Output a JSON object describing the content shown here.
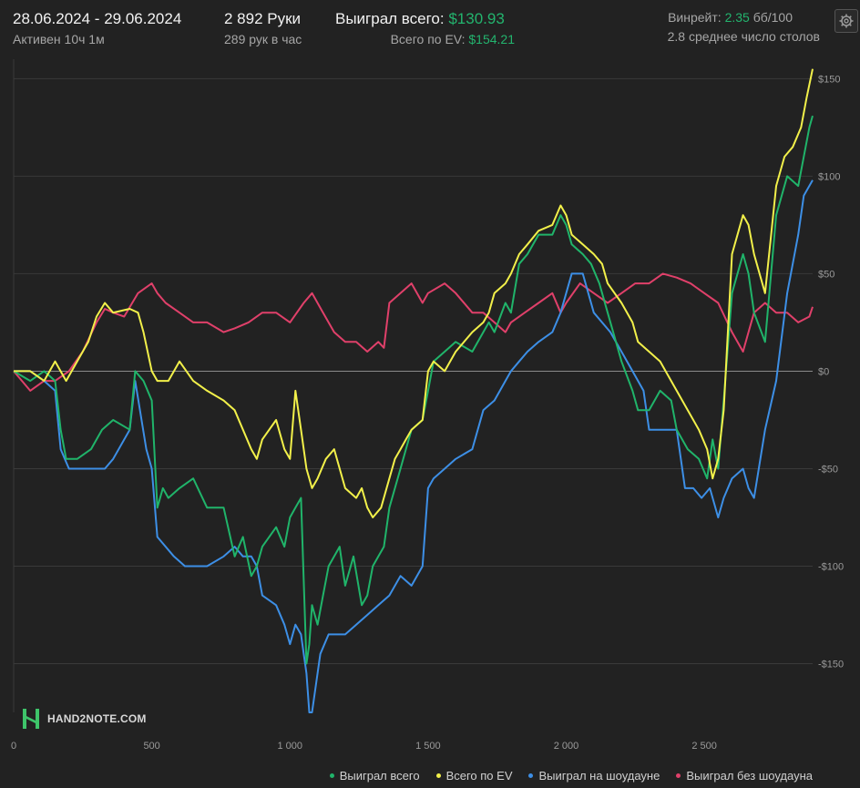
{
  "header": {
    "date_range": "28.06.2024 - 29.06.2024",
    "active_time": "Активен 10ч 1м",
    "hands_count": "2 892 Руки",
    "hands_per_hour": "289 рук в час",
    "won_total_label": "Выиграл всего:",
    "won_total_value": "$130.93",
    "ev_total_label": "Всего по EV:",
    "ev_total_value": "$154.21",
    "winrate_label": "Винрейт:",
    "winrate_value": "2.35",
    "winrate_unit": "бб/100",
    "avg_tables": "2.8 среднее число столов"
  },
  "settings_icon": "gear-icon",
  "logo": {
    "icon": "hand2note-logo-icon",
    "text": "HAND2NOTE.COM"
  },
  "colors": {
    "background": "#222222",
    "grid": "#3a3a3a",
    "zero_line": "#8a8a8a",
    "won_total": "#20b46a",
    "ev_total": "#f2f04a",
    "showdown": "#3d8fe6",
    "non_showdown": "#e0406a",
    "accent_green": "#23b46e"
  },
  "legend": [
    {
      "label": "Выиграл всего",
      "color": "#20b46a"
    },
    {
      "label": "Всего по EV",
      "color": "#f2f04a"
    },
    {
      "label": "Выиграл на шоудауне",
      "color": "#3d8fe6"
    },
    {
      "label": "Выиграл без шоудауна",
      "color": "#e0406a"
    }
  ],
  "chart_data": {
    "type": "line",
    "xlabel": "",
    "ylabel": "",
    "xlim": [
      0,
      2892
    ],
    "ylim": [
      -175,
      160
    ],
    "x_ticks": [
      0,
      500,
      1000,
      1500,
      2000,
      2500
    ],
    "x_tick_labels": [
      "0",
      "500",
      "1 000",
      "1 500",
      "2 000",
      "2 500"
    ],
    "y_ticks": [
      150,
      100,
      50,
      0,
      -50,
      -100,
      -150
    ],
    "y_tick_labels": [
      "$150",
      "$100",
      "$50",
      "$0",
      "-$50",
      "-$100",
      "-$150"
    ],
    "grid": true,
    "legend_position": "bottom-right",
    "series": [
      {
        "name": "Выиграл всего",
        "color": "#20b46a",
        "x": [
          0,
          60,
          110,
          150,
          170,
          190,
          230,
          280,
          320,
          360,
          420,
          440,
          470,
          500,
          520,
          540,
          560,
          600,
          650,
          700,
          760,
          800,
          830,
          860,
          880,
          900,
          950,
          980,
          1000,
          1020,
          1040,
          1060,
          1070,
          1080,
          1100,
          1120,
          1140,
          1180,
          1200,
          1230,
          1260,
          1280,
          1300,
          1320,
          1340,
          1360,
          1380,
          1400,
          1420,
          1440,
          1480,
          1500,
          1520,
          1560,
          1600,
          1660,
          1700,
          1720,
          1740,
          1780,
          1800,
          1830,
          1860,
          1900,
          1950,
          1980,
          2000,
          2020,
          2060,
          2090,
          2120,
          2150,
          2200,
          2240,
          2260,
          2300,
          2340,
          2380,
          2400,
          2440,
          2480,
          2510,
          2530,
          2550,
          2570,
          2600,
          2640,
          2660,
          2680,
          2720,
          2760,
          2800,
          2840,
          2860,
          2880,
          2892
        ],
        "y": [
          0,
          -5,
          0,
          -5,
          -30,
          -45,
          -45,
          -40,
          -30,
          -25,
          -30,
          0,
          -5,
          -15,
          -70,
          -60,
          -65,
          -60,
          -55,
          -70,
          -70,
          -95,
          -85,
          -105,
          -100,
          -90,
          -80,
          -90,
          -75,
          -70,
          -65,
          -150,
          -140,
          -120,
          -130,
          -115,
          -100,
          -90,
          -110,
          -95,
          -120,
          -115,
          -100,
          -95,
          -90,
          -70,
          -60,
          -50,
          -40,
          -30,
          -25,
          -10,
          5,
          10,
          15,
          10,
          20,
          25,
          20,
          35,
          30,
          55,
          60,
          70,
          70,
          80,
          75,
          65,
          60,
          55,
          45,
          30,
          5,
          -10,
          -20,
          -20,
          -10,
          -15,
          -30,
          -40,
          -45,
          -55,
          -35,
          -50,
          -15,
          40,
          60,
          50,
          30,
          15,
          80,
          100,
          95,
          110,
          125,
          131
        ]
      },
      {
        "name": "Всего по EV",
        "color": "#f2f04a",
        "x": [
          0,
          60,
          110,
          150,
          190,
          230,
          270,
          300,
          330,
          360,
          420,
          450,
          470,
          500,
          520,
          560,
          600,
          650,
          700,
          760,
          800,
          830,
          860,
          880,
          900,
          950,
          980,
          1000,
          1020,
          1040,
          1060,
          1080,
          1100,
          1130,
          1160,
          1200,
          1240,
          1260,
          1280,
          1300,
          1330,
          1360,
          1380,
          1400,
          1420,
          1440,
          1480,
          1500,
          1520,
          1560,
          1600,
          1660,
          1700,
          1720,
          1740,
          1780,
          1800,
          1830,
          1860,
          1900,
          1950,
          1980,
          2000,
          2020,
          2060,
          2100,
          2130,
          2150,
          2200,
          2240,
          2260,
          2300,
          2340,
          2380,
          2400,
          2440,
          2480,
          2510,
          2530,
          2550,
          2570,
          2600,
          2640,
          2660,
          2680,
          2720,
          2760,
          2790,
          2820,
          2850,
          2870,
          2892
        ],
        "y": [
          0,
          0,
          -5,
          5,
          -5,
          5,
          15,
          28,
          35,
          30,
          32,
          30,
          20,
          0,
          -5,
          -5,
          5,
          -5,
          -10,
          -15,
          -20,
          -30,
          -40,
          -45,
          -35,
          -25,
          -40,
          -45,
          -10,
          -30,
          -50,
          -60,
          -55,
          -45,
          -40,
          -60,
          -65,
          -60,
          -70,
          -75,
          -70,
          -55,
          -45,
          -40,
          -35,
          -30,
          -25,
          0,
          5,
          0,
          10,
          20,
          25,
          30,
          40,
          45,
          50,
          60,
          65,
          72,
          75,
          85,
          80,
          70,
          65,
          60,
          55,
          45,
          35,
          25,
          15,
          10,
          5,
          -5,
          -10,
          -20,
          -30,
          -40,
          -55,
          -45,
          -20,
          60,
          80,
          75,
          60,
          40,
          95,
          110,
          115,
          125,
          140,
          155
        ]
      },
      {
        "name": "Выиграл на шоудауне",
        "color": "#3d8fe6",
        "x": [
          0,
          60,
          110,
          150,
          170,
          200,
          250,
          300,
          330,
          360,
          420,
          440,
          480,
          500,
          520,
          580,
          620,
          700,
          760,
          800,
          830,
          860,
          880,
          900,
          950,
          980,
          1000,
          1020,
          1040,
          1060,
          1070,
          1080,
          1110,
          1140,
          1200,
          1240,
          1280,
          1320,
          1360,
          1400,
          1440,
          1480,
          1500,
          1520,
          1560,
          1600,
          1660,
          1700,
          1740,
          1780,
          1800,
          1830,
          1860,
          1900,
          1950,
          1980,
          2000,
          2020,
          2060,
          2100,
          2160,
          2200,
          2240,
          2280,
          2300,
          2400,
          2430,
          2460,
          2490,
          2520,
          2550,
          2570,
          2600,
          2640,
          2660,
          2680,
          2720,
          2760,
          2800,
          2840,
          2860,
          2892
        ],
        "y": [
          0,
          0,
          -5,
          -10,
          -40,
          -50,
          -50,
          -50,
          -50,
          -45,
          -30,
          -5,
          -40,
          -50,
          -85,
          -95,
          -100,
          -100,
          -95,
          -90,
          -95,
          -95,
          -100,
          -115,
          -120,
          -130,
          -140,
          -130,
          -135,
          -155,
          -175,
          -175,
          -145,
          -135,
          -135,
          -130,
          -125,
          -120,
          -115,
          -105,
          -110,
          -100,
          -60,
          -55,
          -50,
          -45,
          -40,
          -20,
          -15,
          -5,
          0,
          5,
          10,
          15,
          20,
          30,
          40,
          50,
          50,
          30,
          20,
          10,
          0,
          -10,
          -30,
          -30,
          -60,
          -60,
          -65,
          -60,
          -75,
          -65,
          -55,
          -50,
          -60,
          -65,
          -30,
          -5,
          40,
          70,
          90,
          98
        ]
      },
      {
        "name": "Выиграл без шоудауна",
        "color": "#e0406a",
        "x": [
          0,
          60,
          110,
          150,
          200,
          250,
          300,
          330,
          360,
          400,
          450,
          500,
          520,
          550,
          600,
          650,
          700,
          760,
          800,
          850,
          900,
          950,
          1000,
          1050,
          1080,
          1120,
          1160,
          1200,
          1240,
          1280,
          1320,
          1340,
          1360,
          1400,
          1440,
          1480,
          1500,
          1560,
          1600,
          1660,
          1700,
          1740,
          1780,
          1800,
          1850,
          1900,
          1950,
          1980,
          2000,
          2050,
          2100,
          2150,
          2200,
          2250,
          2300,
          2350,
          2400,
          2450,
          2500,
          2550,
          2600,
          2640,
          2660,
          2680,
          2720,
          2760,
          2800,
          2840,
          2880,
          2892
        ],
        "y": [
          0,
          -10,
          -5,
          -5,
          0,
          10,
          25,
          32,
          30,
          28,
          40,
          45,
          40,
          35,
          30,
          25,
          25,
          20,
          22,
          25,
          30,
          30,
          25,
          35,
          40,
          30,
          20,
          15,
          15,
          10,
          15,
          12,
          35,
          40,
          45,
          35,
          40,
          45,
          40,
          30,
          30,
          25,
          20,
          25,
          30,
          35,
          40,
          30,
          35,
          45,
          40,
          35,
          40,
          45,
          45,
          50,
          48,
          45,
          40,
          35,
          20,
          10,
          20,
          30,
          35,
          30,
          30,
          25,
          28,
          33
        ]
      }
    ]
  }
}
